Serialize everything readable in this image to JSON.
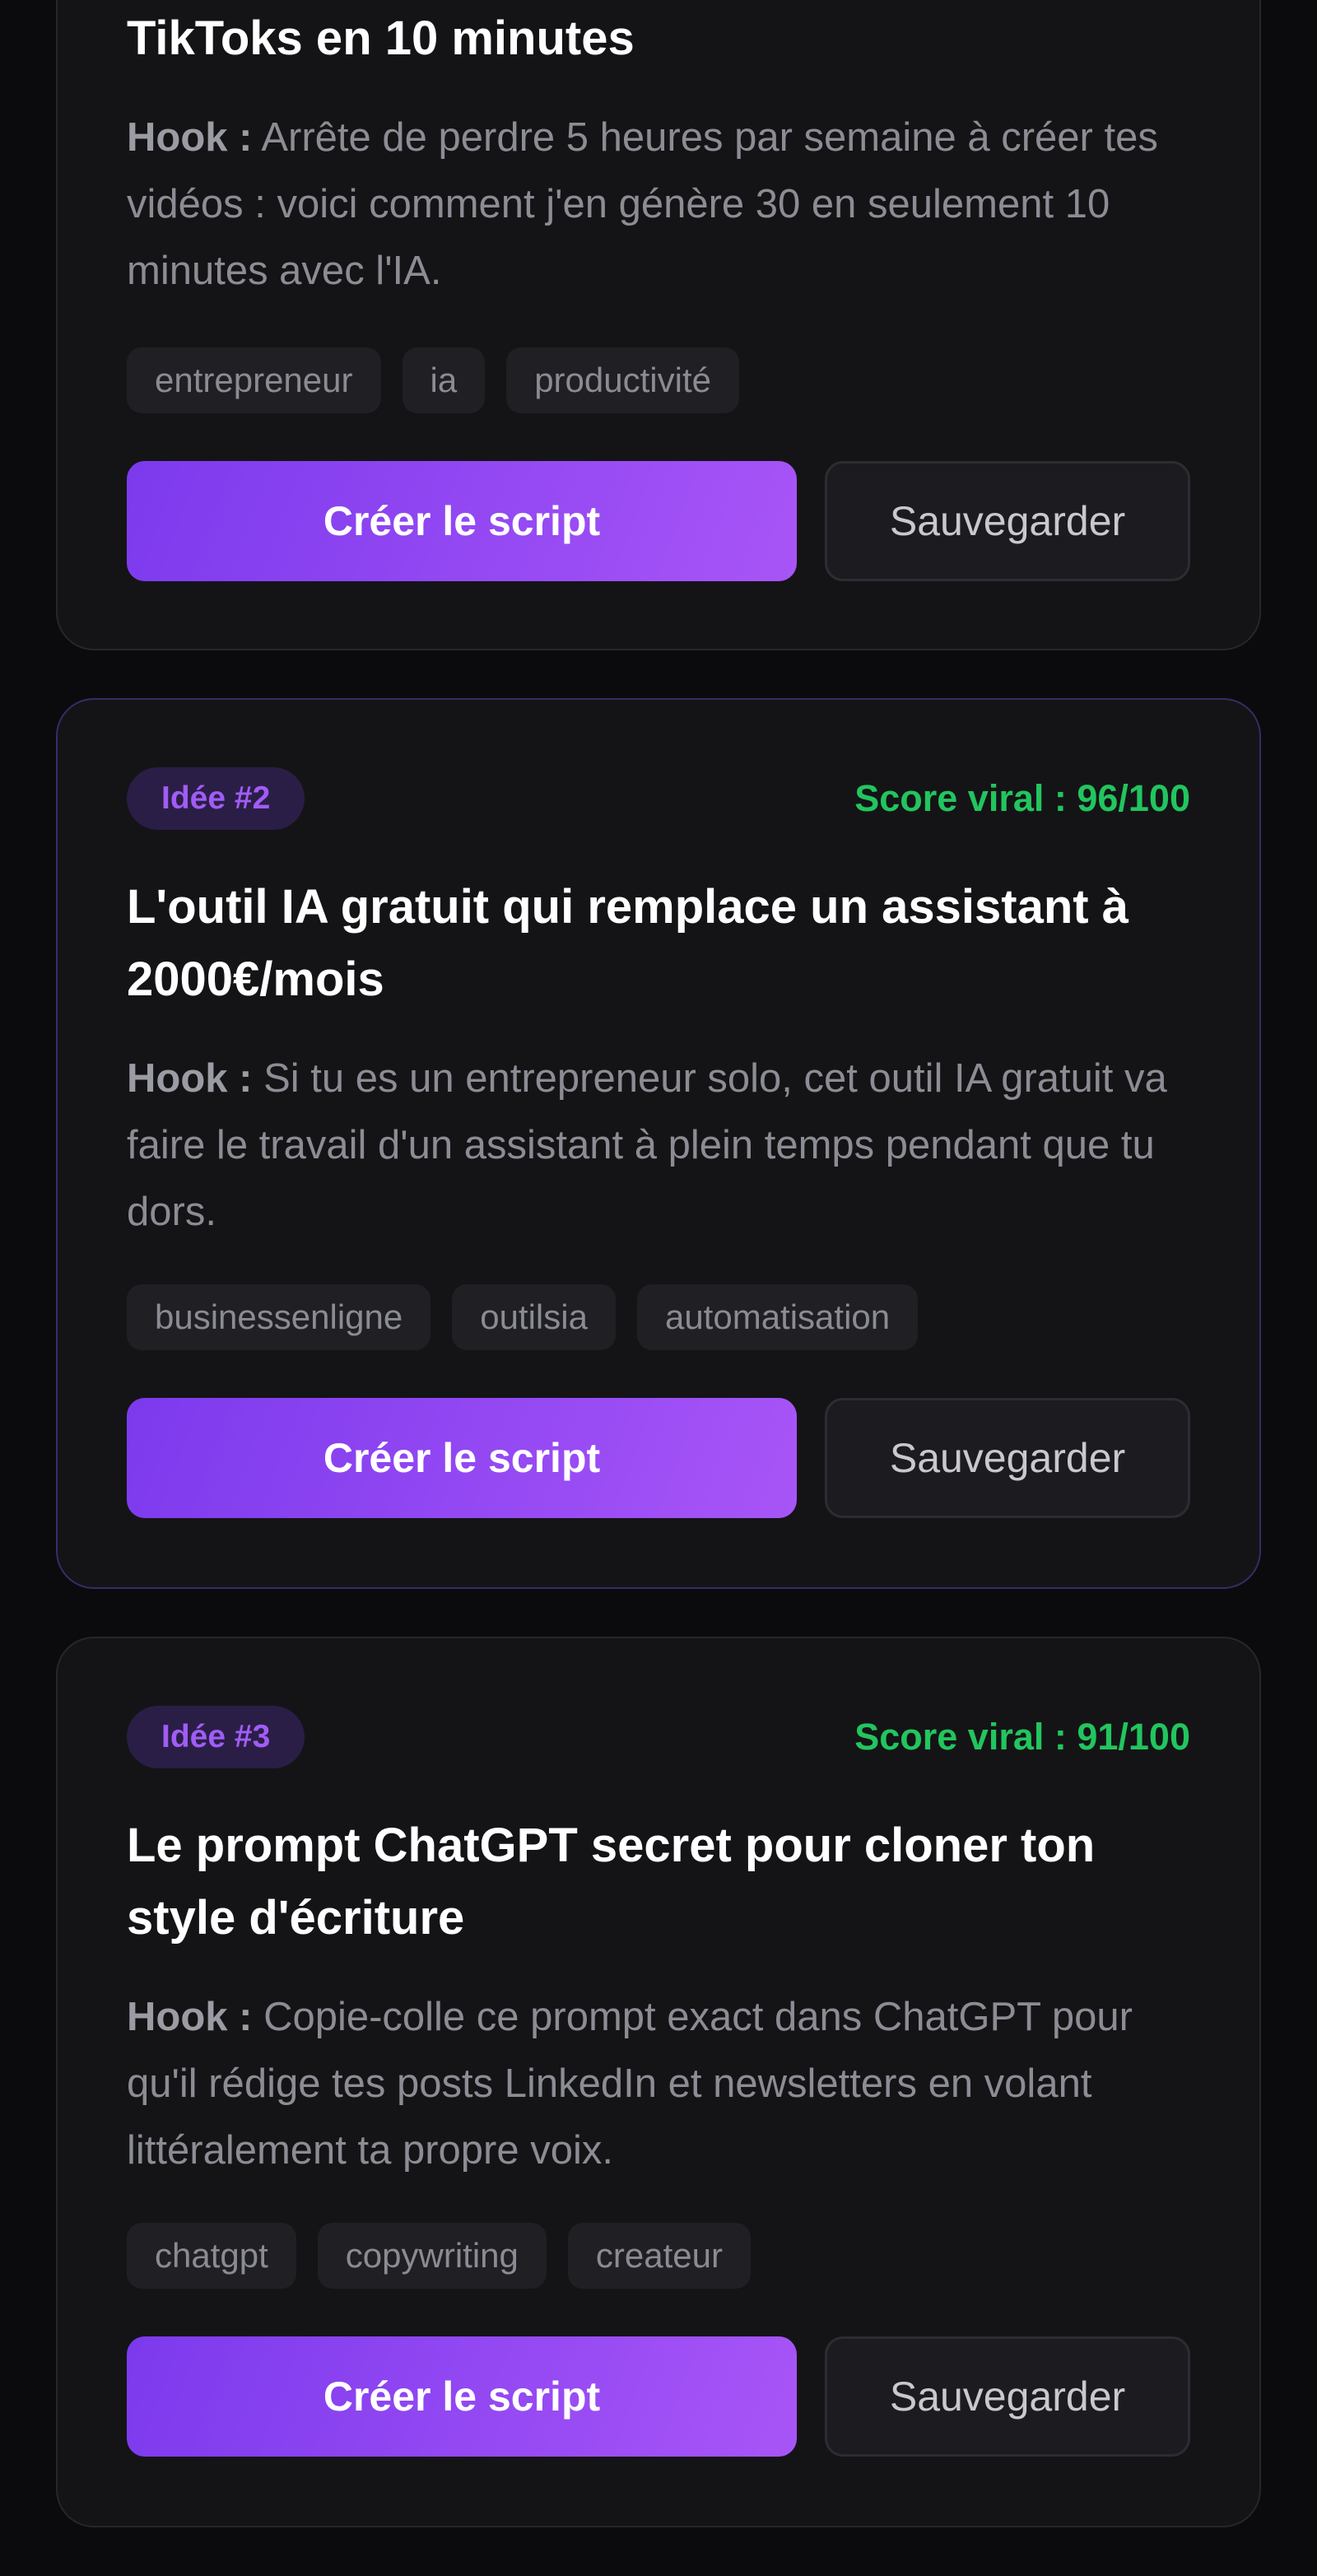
{
  "cards": [
    {
      "title_tail": "TikToks en 10 minutes",
      "hook_label": "Hook :",
      "hook_text": "Arrête de perdre 5 heures par semaine à créer tes vidéos : voici comment j'en génère 30 en seulement 10 minutes avec l'IA.",
      "tags": [
        "entrepreneur",
        "ia",
        "productivité"
      ],
      "primary_label": "Créer le script",
      "secondary_label": "Sauvegarder"
    },
    {
      "badge": "Idée #2",
      "score": "Score viral : 96/100",
      "title": "L'outil IA gratuit qui remplace un assistant à 2000€/mois",
      "hook_label": "Hook :",
      "hook_text": "Si tu es un entrepreneur solo, cet outil IA gratuit va faire le travail d'un assistant à plein temps pendant que tu dors.",
      "tags": [
        "businessenligne",
        "outilsia",
        "automatisation"
      ],
      "primary_label": "Créer le script",
      "secondary_label": "Sauvegarder"
    },
    {
      "badge": "Idée #3",
      "score": "Score viral : 91/100",
      "title": "Le prompt ChatGPT secret pour cloner ton style d'écriture",
      "hook_label": "Hook :",
      "hook_text": "Copie-colle ce prompt exact dans ChatGPT pour qu'il rédige tes posts LinkedIn et newsletters en volant littéralement ta propre voix.",
      "tags": [
        "chatgpt",
        "copywriting",
        "createur"
      ],
      "primary_label": "Créer le script",
      "secondary_label": "Sauvegarder"
    }
  ],
  "colors": {
    "background": "#0b0b0e",
    "card": "#141417",
    "accent": "#8b47f5",
    "score": "#22c55e",
    "badge_text": "#a15cf5"
  }
}
